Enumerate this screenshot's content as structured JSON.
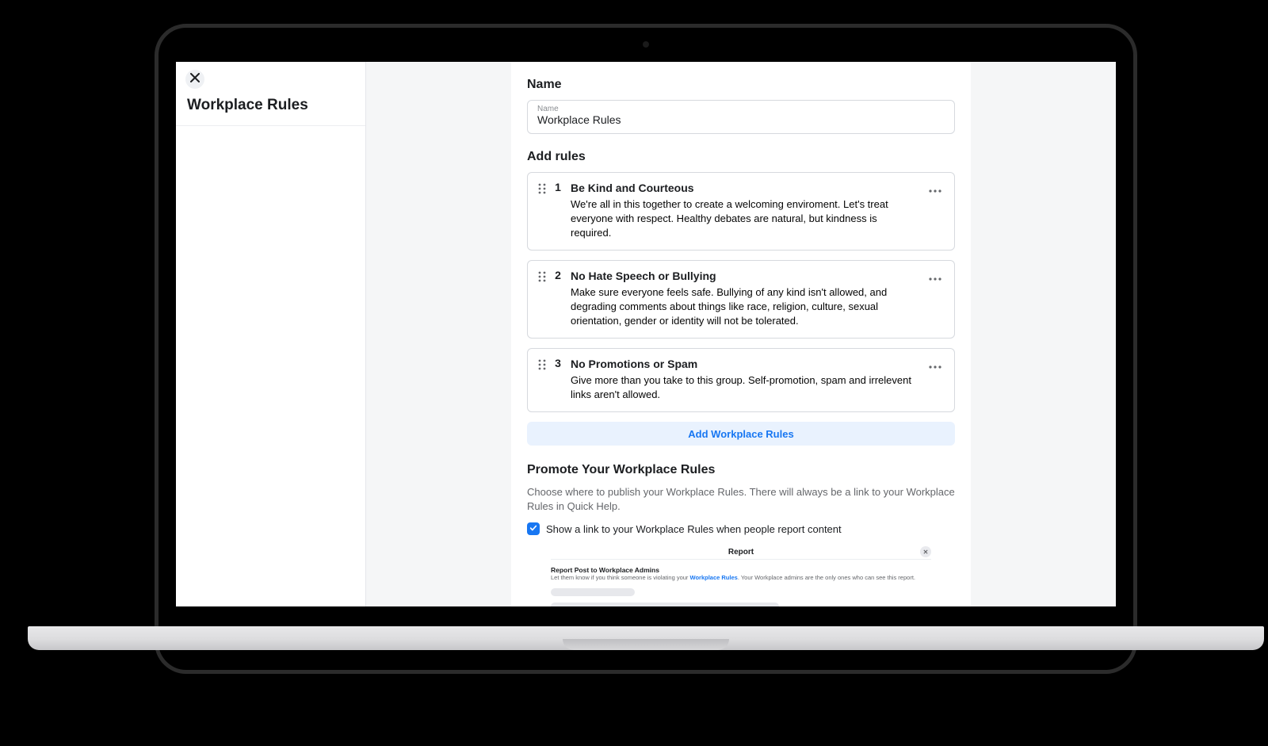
{
  "sidebar": {
    "title": "Workplace Rules"
  },
  "name_section": {
    "heading": "Name",
    "field_label": "Name",
    "value": "Workplace Rules"
  },
  "rules_section": {
    "heading": "Add rules",
    "add_button": "Add Workplace Rules",
    "rules": [
      {
        "index": "1",
        "title": "Be Kind and Courteous",
        "description": "We're all in this together to create a welcoming enviroment. Let's treat everyone with respect. Healthy debates are natural, but kindness is required."
      },
      {
        "index": "2",
        "title": "No Hate Speech or Bullying",
        "description": "Make sure everyone feels safe. Bullying of any kind isn't allowed, and degrading comments about things like race, religion, culture, sexual orientation, gender or identity will not be tolerated."
      },
      {
        "index": "3",
        "title": "No Promotions or Spam",
        "description": "Give more than you take to this group. Self-promotion, spam and irrelevent links aren't allowed."
      }
    ]
  },
  "promote_section": {
    "heading": "Promote Your Workplace Rules",
    "sub": "Choose where to publish your Workplace Rules. There will always be a link to your Workplace Rules in Quick Help.",
    "checkbox_label": "Show a link to your Workplace Rules when people report content",
    "preview": {
      "header": "Report",
      "title": "Report Post to Workplace Admins",
      "text_before": "Let them know if you think someone is violating your ",
      "link": "Workplace Rules",
      "text_after": ". Your Workplace admins are the only ones who can see this report."
    }
  }
}
